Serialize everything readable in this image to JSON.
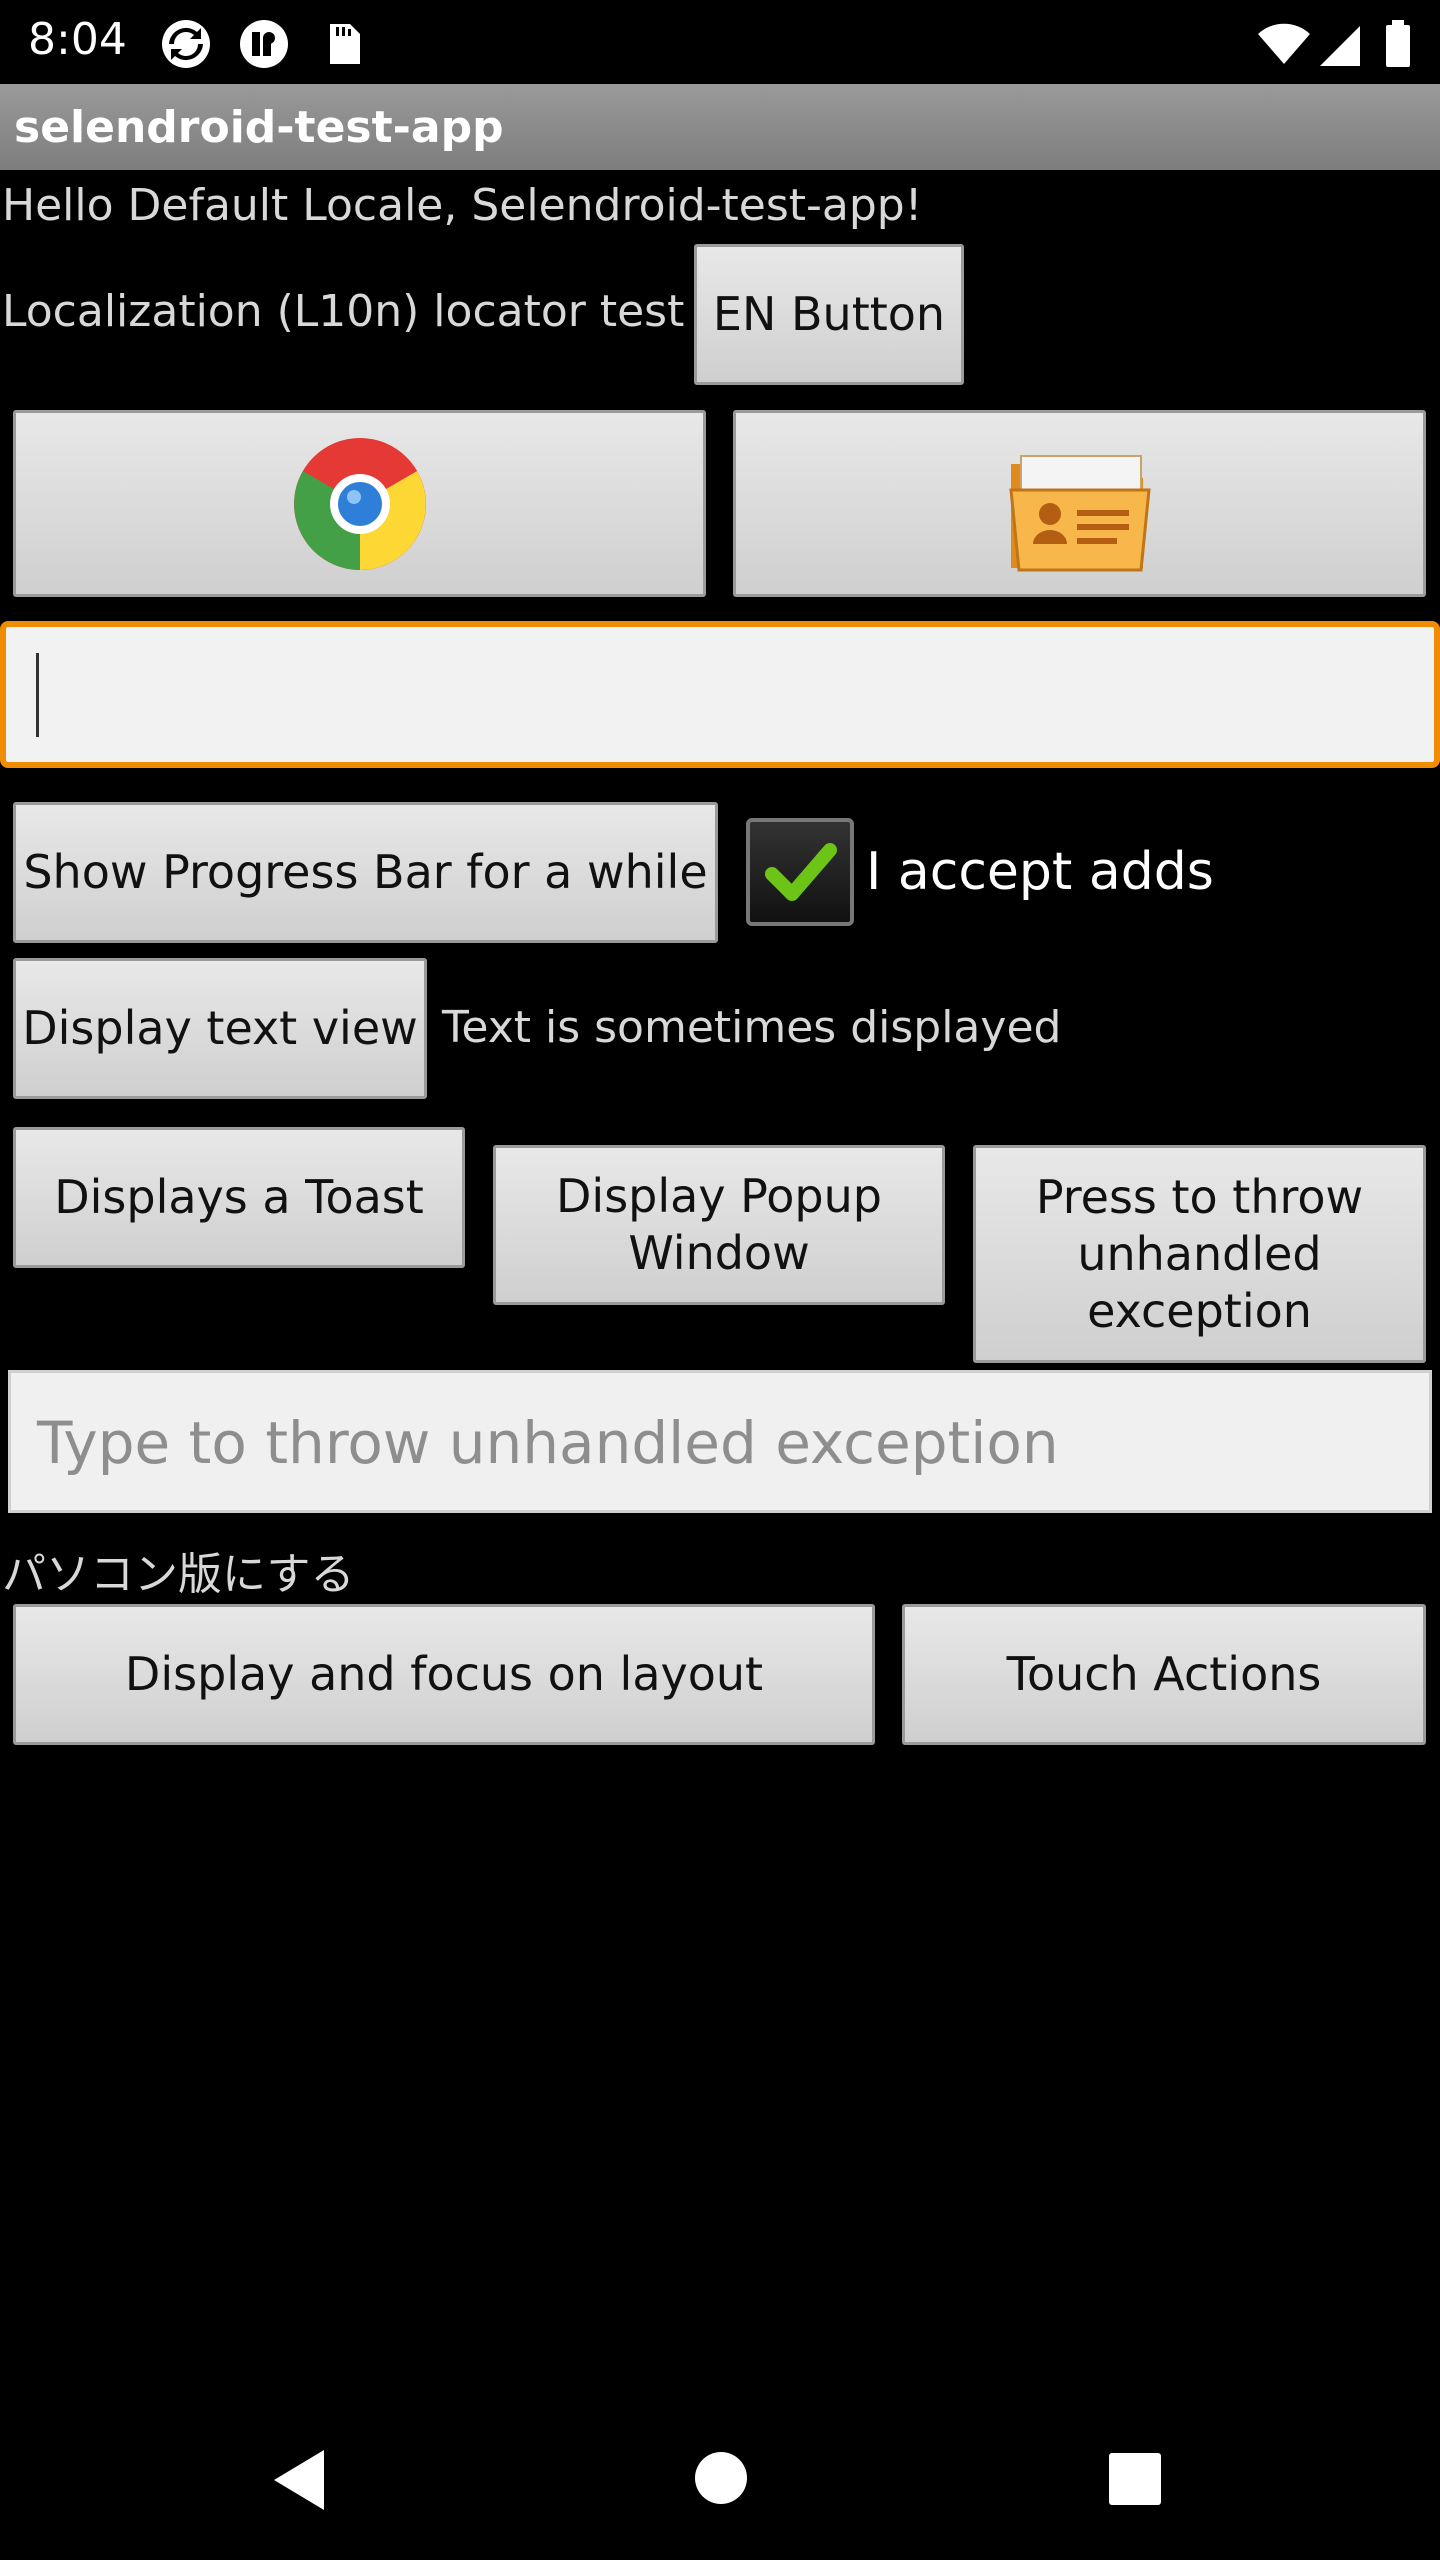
{
  "status_bar": {
    "time": "8:04",
    "left_icons": [
      "sync-icon",
      "app-badge-icon",
      "sd-card-icon"
    ],
    "right_icons": [
      "wifi-icon",
      "cell-signal-icon",
      "battery-icon"
    ]
  },
  "app": {
    "title": "selendroid-test-app"
  },
  "main": {
    "hello_text": "Hello Default Locale, Selendroid-test-app!",
    "l10n_label": "Localization (L10n) locator test",
    "en_button": "EN Button",
    "chrome_button_icon": "chrome-icon",
    "contacts_button_icon": "contacts-folder-icon",
    "text_input_value": "",
    "progress_button": "Show Progress Bar for a while",
    "accept_checkbox_label": "I accept adds",
    "accept_checked": true,
    "display_text_view_button": "Display text view",
    "sometimes_text": "Text is sometimes displayed",
    "toast_button": "Displays a Toast",
    "popup_button": "Display Popup Window",
    "exception_button": "Press to throw unhandled exception",
    "exception_input_placeholder": "Type to throw unhandled exception",
    "japanese_text": "パソコン版にする",
    "focus_layout_button": "Display and focus on layout",
    "touch_actions_button": "Touch Actions"
  },
  "nav_bar": {
    "back": "back-icon",
    "home": "home-icon",
    "recents": "recents-icon"
  },
  "colors": {
    "focus_border": "#f08c00",
    "check_green": "#6cc417"
  }
}
